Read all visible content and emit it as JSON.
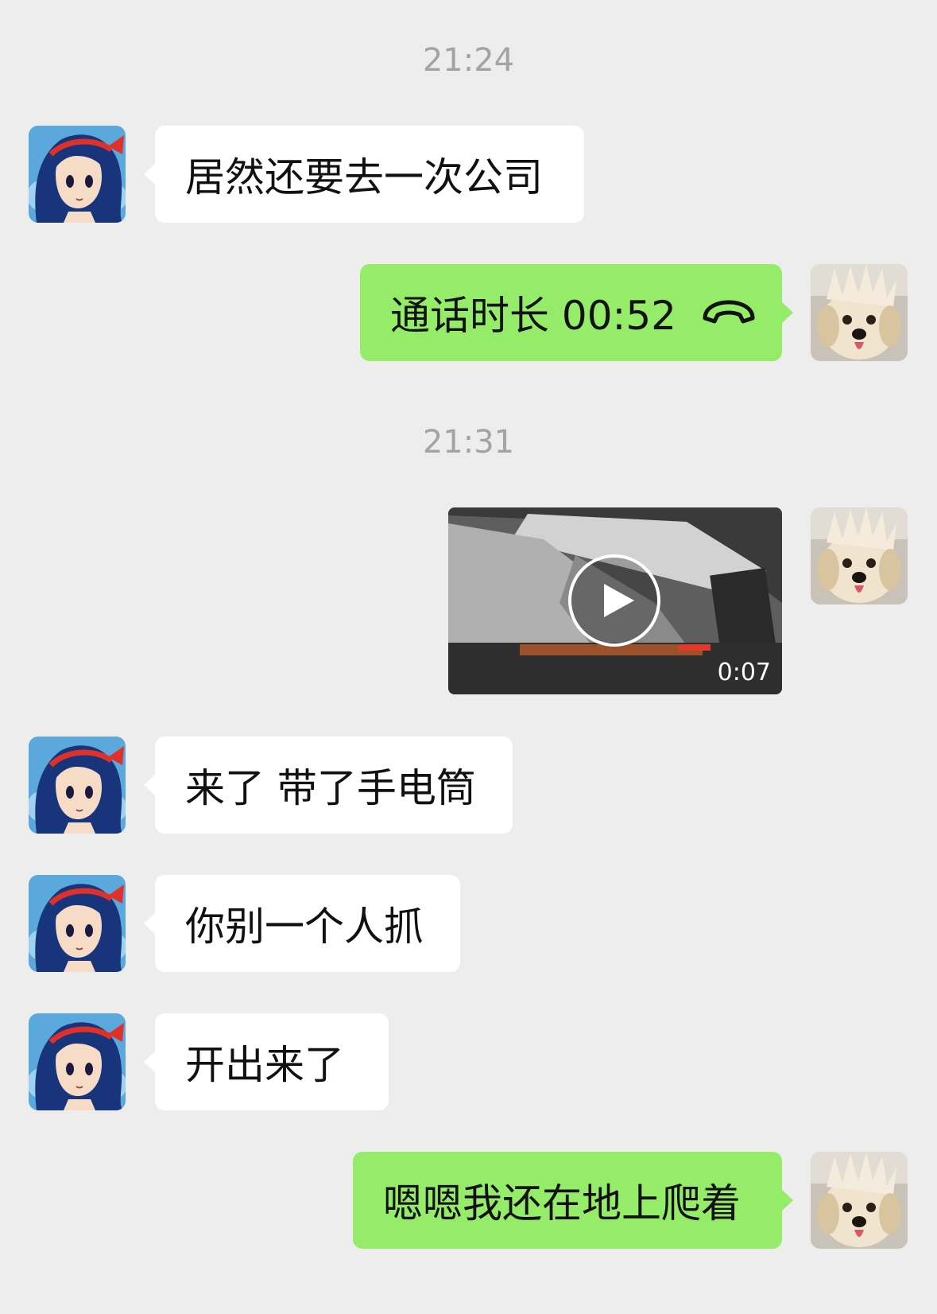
{
  "messages": {
    "ts1": "21:24",
    "m1": "居然还要去一次公司",
    "call_label": "通话时长 00:52",
    "ts2": "21:31",
    "video_duration": "0:07",
    "m2": "来了 带了手电筒",
    "m3": "你别一个人抓",
    "m4": "开出来了",
    "m5": "嗯嗯我还在地上爬着"
  },
  "icons": {
    "call": "phone-hangup-icon",
    "play": "play-icon"
  },
  "colors": {
    "background": "#ededed",
    "incoming_bubble": "#ffffff",
    "outgoing_bubble": "#95ec69",
    "timestamp": "#a3a3a3"
  }
}
